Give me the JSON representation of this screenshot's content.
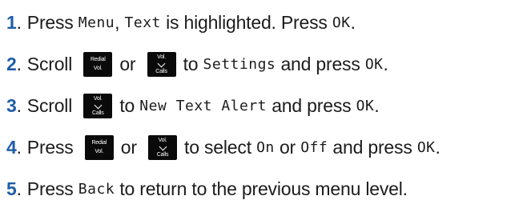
{
  "steps": [
    {
      "number": "1",
      "parts": [
        {
          "t": "text",
          "v": "Press "
        },
        {
          "t": "lcd",
          "v": "Menu"
        },
        {
          "t": "text",
          "v": ", "
        },
        {
          "t": "lcd",
          "v": "Text"
        },
        {
          "t": "text",
          "v": " is highlighted. Press "
        },
        {
          "t": "lcd",
          "v": "OK"
        },
        {
          "t": "text",
          "v": "."
        }
      ]
    },
    {
      "number": "2",
      "parts": [
        {
          "t": "text",
          "v": "Scroll "
        },
        {
          "t": "key",
          "kind": "redial"
        },
        {
          "t": "text",
          "v": "or "
        },
        {
          "t": "key",
          "kind": "down"
        },
        {
          "t": "text",
          "v": "to "
        },
        {
          "t": "lcd",
          "v": "Settings"
        },
        {
          "t": "text",
          "v": " and press "
        },
        {
          "t": "lcd",
          "v": "OK"
        },
        {
          "t": "text",
          "v": "."
        }
      ]
    },
    {
      "number": "3",
      "parts": [
        {
          "t": "text",
          "v": "Scroll "
        },
        {
          "t": "key",
          "kind": "down"
        },
        {
          "t": "text",
          "v": "to "
        },
        {
          "t": "lcd",
          "v": "New Text Alert"
        },
        {
          "t": "text",
          "v": " and press "
        },
        {
          "t": "lcd",
          "v": "OK"
        },
        {
          "t": "text",
          "v": "."
        }
      ]
    },
    {
      "number": "4",
      "parts": [
        {
          "t": "text",
          "v": "Press "
        },
        {
          "t": "key",
          "kind": "redial"
        },
        {
          "t": "text",
          "v": "or "
        },
        {
          "t": "key",
          "kind": "down"
        },
        {
          "t": "text",
          "v": "to select "
        },
        {
          "t": "lcd",
          "v": "On"
        },
        {
          "t": "text",
          "v": " or "
        },
        {
          "t": "lcd",
          "v": "Off"
        },
        {
          "t": "text",
          "v": " and press "
        },
        {
          "t": "lcd",
          "v": "OK"
        },
        {
          "t": "text",
          "v": "."
        }
      ]
    },
    {
      "number": "5",
      "parts": [
        {
          "t": "text",
          "v": "Press "
        },
        {
          "t": "lcd",
          "v": "Back"
        },
        {
          "t": "text",
          "v": " to return to the previous menu level."
        }
      ]
    }
  ],
  "keys": {
    "redial": {
      "top": "Redial",
      "bottom": "Vol.",
      "icon": "redial-vol-key-icon"
    },
    "down": {
      "top": "Vol.",
      "bottom": "Calls",
      "icon": "vol-calls-down-key-icon"
    }
  },
  "colors": {
    "step_number": "#1f5da8",
    "key_background": "#0a0a0a"
  }
}
